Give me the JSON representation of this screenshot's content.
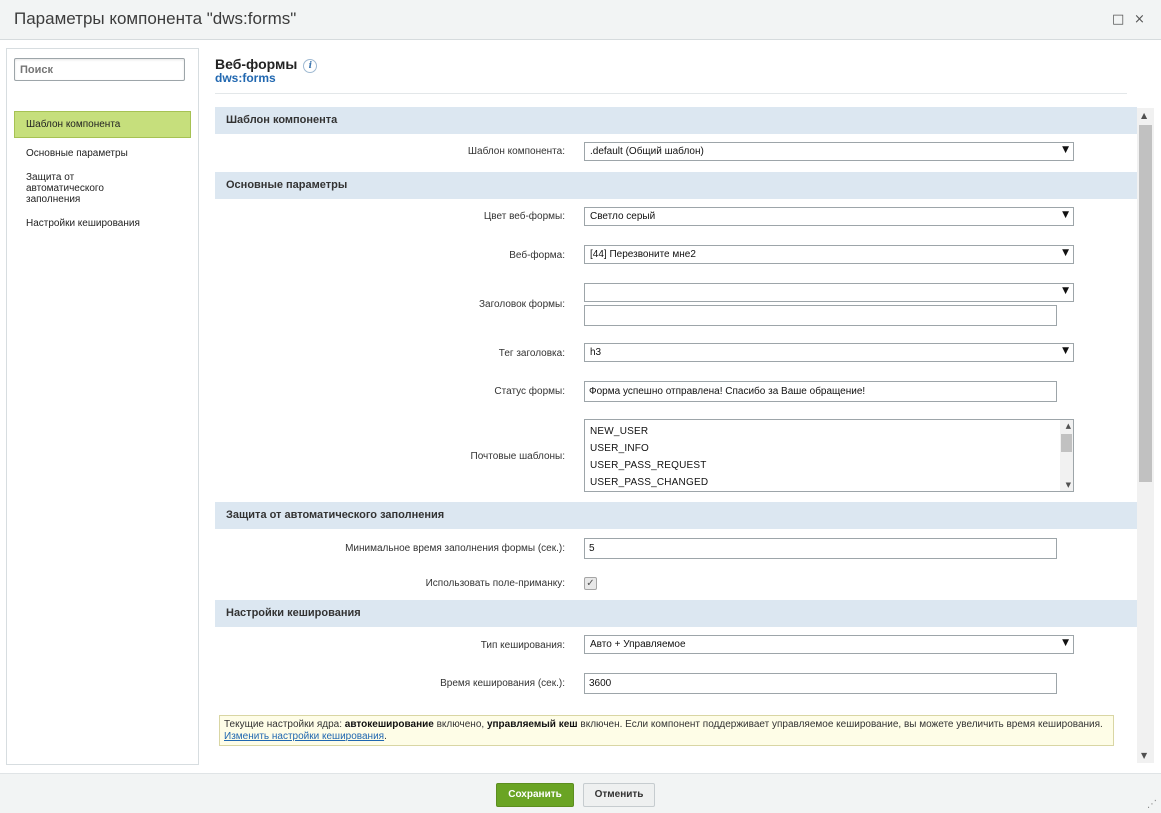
{
  "window": {
    "title": "Параметры компонента \"dws:forms\"",
    "maximize_icon": "□",
    "close_icon": "×"
  },
  "sidebar": {
    "search_placeholder": "Поиск",
    "items": [
      {
        "label": "Шаблон компонента",
        "active": true
      },
      {
        "label": "Основные параметры",
        "active": false
      },
      {
        "label": "Защита от автоматического заполнения",
        "active": false
      },
      {
        "label": "Настройки кеширования",
        "active": false
      }
    ]
  },
  "header": {
    "name": "Веб-формы",
    "info_icon": "i",
    "code": "dws:forms"
  },
  "sections": {
    "template": {
      "title": "Шаблон компонента",
      "template_label": "Шаблон компонента:",
      "template_value": ".default (Общий шаблон)"
    },
    "main": {
      "title": "Основные параметры",
      "color_label": "Цвет веб-формы:",
      "color_value": "Светло серый",
      "form_label": "Веб-форма:",
      "form_value": "[44] Перезвоните мне2",
      "heading_label": "Заголовок формы:",
      "heading_value": "",
      "heading_text": "",
      "tag_label": "Тег заголовка:",
      "tag_value": "h3",
      "status_label": "Статус формы:",
      "status_value": "Форма успешно отправлена! Спасибо за Ваше обращение!",
      "mail_label": "Почтовые шаблоны:",
      "mail_options": [
        "NEW_USER",
        "USER_INFO",
        "USER_PASS_REQUEST",
        "USER_PASS_CHANGED"
      ]
    },
    "antispam": {
      "title": "Защита от автоматического заполнения",
      "min_time_label": "Минимальное время заполнения формы (сек.):",
      "min_time_value": "5",
      "honeypot_label": "Использовать поле-приманку:",
      "honeypot_checked": true
    },
    "cache": {
      "title": "Настройки кеширования",
      "type_label": "Тип кеширования:",
      "type_value": "Авто + Управляемое",
      "time_label": "Время кеширования (сек.):",
      "time_value": "3600"
    }
  },
  "note": {
    "part1": "Текущие настройки ядра: ",
    "bold1": "автокеширование",
    "part2": " включено, ",
    "bold2": "управляемый кеш",
    "part3": " включен. Если компонент поддерживает управляемое кеширование, вы можете увеличить время кеширования. ",
    "link": "Изменить настройки кеширования",
    "part4": "."
  },
  "footer": {
    "save_label": "Сохранить",
    "cancel_label": "Отменить"
  },
  "colors": {
    "accent_green": "#6aa424",
    "active_nav": "#c6df7c",
    "section_bg": "#dce7f1",
    "link_blue": "#2067b0",
    "note_bg": "#fefde7"
  }
}
